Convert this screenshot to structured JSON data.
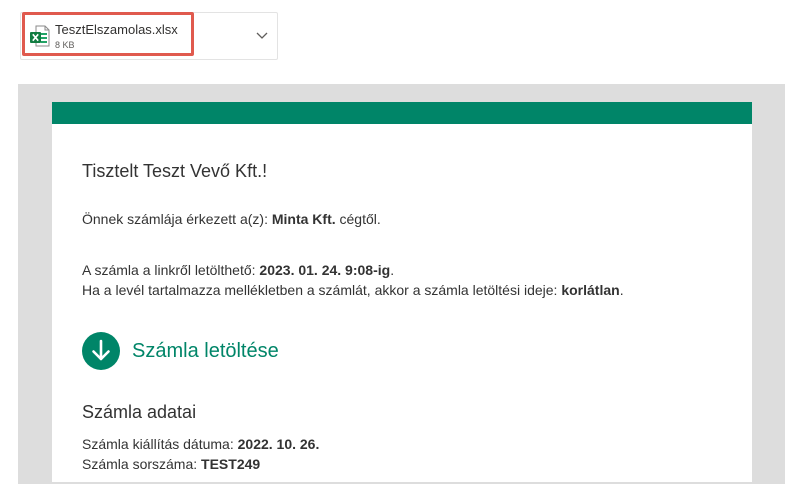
{
  "attachment": {
    "file_name": "TesztElszamolas.xlsx",
    "file_size": "8 KB",
    "icon": "excel-file-icon"
  },
  "email": {
    "greeting": "Tisztelt Teszt Vevő Kft.!",
    "line1": {
      "prefix": "Önnek számlája érkezett a(z): ",
      "sender": "Minta Kft.",
      "suffix": " cégtől."
    },
    "line2": {
      "prefix": "A számla a linkről letölthető: ",
      "deadline": "2023. 01. 24. 9:08-ig",
      "suffix": "."
    },
    "line3": {
      "prefix": "Ha a levél tartalmazza mellékletben a számlát, akkor a számla letöltési ideje: ",
      "value": "korlátlan",
      "suffix": "."
    },
    "download_label": "Számla letöltése",
    "section_title": "Számla adatai",
    "issue_date": {
      "label": "Számla kiállítás dátuma: ",
      "value": "2022. 10. 26."
    },
    "invoice_number": {
      "label": "Számla sorszáma: ",
      "value": "TEST249"
    }
  },
  "colors": {
    "brand": "#008568",
    "highlight": "#e05a4e",
    "frame": "#dddddd"
  }
}
